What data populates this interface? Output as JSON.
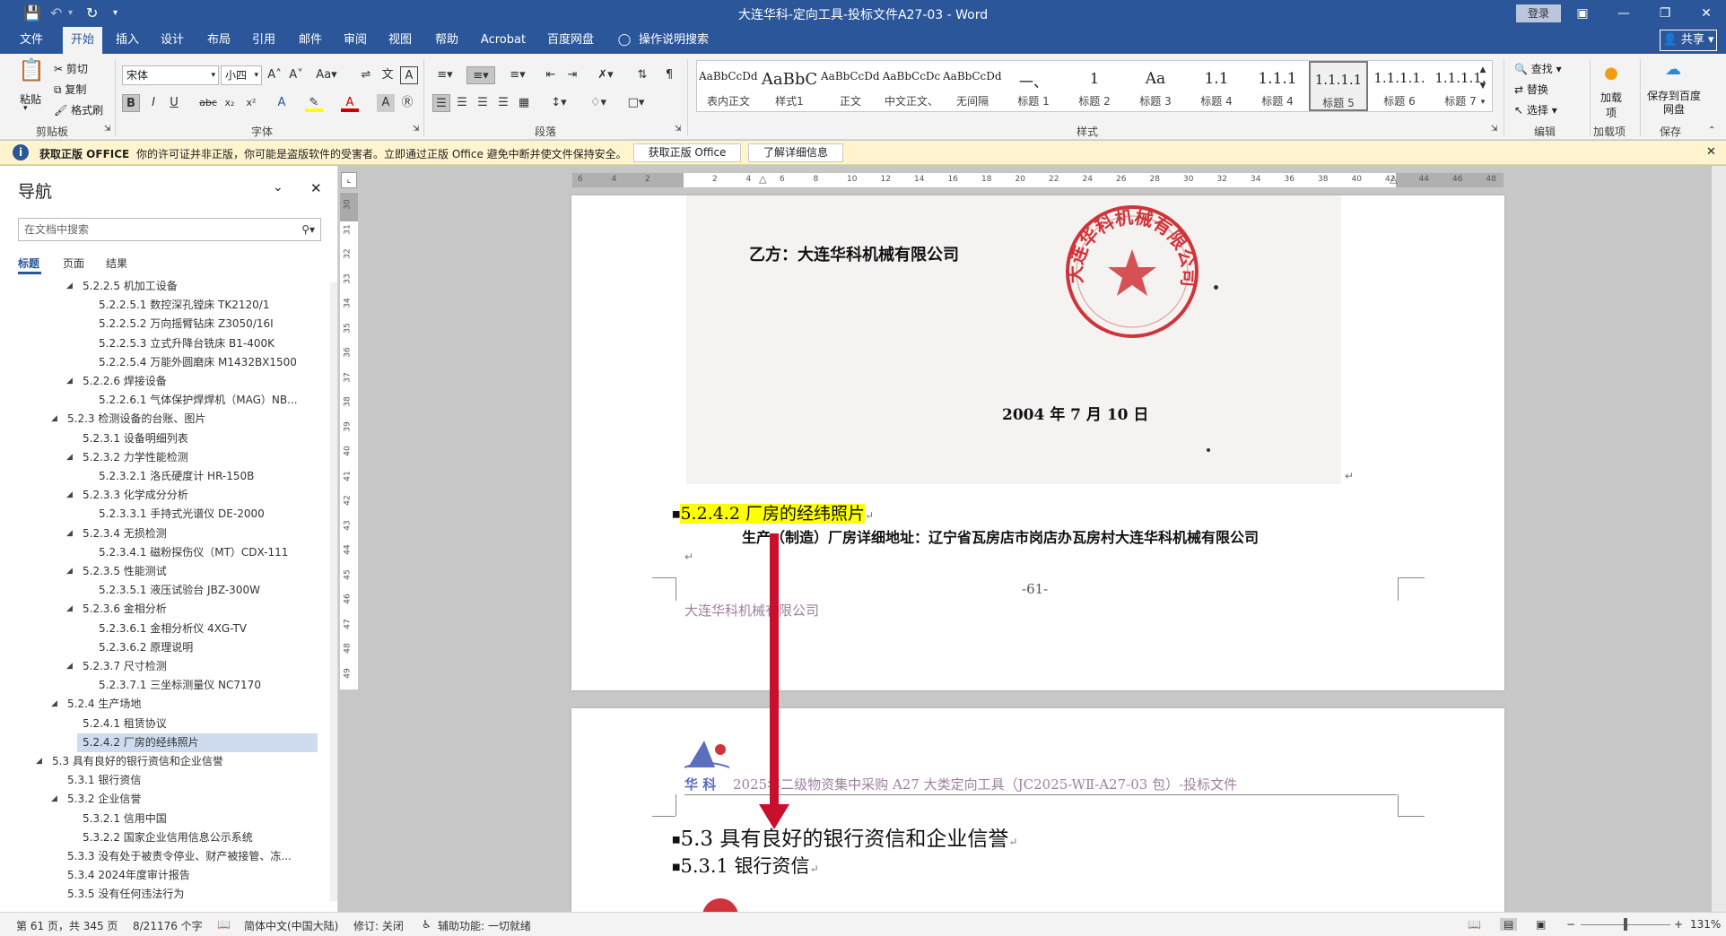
{
  "title": {
    "window_title": "大连华科-定向工具-投标文件A27-03 - Word",
    "login": "登录"
  },
  "menu": {
    "tabs": [
      "文件",
      "开始",
      "插入",
      "设计",
      "布局",
      "引用",
      "邮件",
      "审阅",
      "视图",
      "帮助",
      "Acrobat",
      "百度网盘"
    ],
    "active_tab": "开始",
    "tell_me": "操作说明搜索",
    "share": "共享"
  },
  "ribbon": {
    "clipboard": {
      "paste": "粘贴",
      "cut": "剪切",
      "copy": "复制",
      "format_painter": "格式刷",
      "label": "剪贴板"
    },
    "font": {
      "name": "宋体",
      "size": "小四",
      "label": "字体"
    },
    "paragraph": {
      "label": "段落"
    },
    "styles": {
      "label": "样式",
      "items": [
        {
          "sample": "AaBbCcDdI",
          "name": "表内正文"
        },
        {
          "sample": "AaBbC",
          "name": "样式1"
        },
        {
          "sample": "AaBbCcDdI",
          "name": "正文"
        },
        {
          "sample": "AaBbCcDc",
          "name": "中文正文、"
        },
        {
          "sample": "AaBbCcDdI",
          "name": "无间隔"
        },
        {
          "sample": "一、",
          "name": "标题 1"
        },
        {
          "sample": "1",
          "name": "标题 2"
        },
        {
          "sample": "Aa",
          "name": "标题 3"
        },
        {
          "sample": "1.1",
          "name": "标题 4"
        },
        {
          "sample": "1.1.1",
          "name": "标题 4"
        },
        {
          "sample": "1.1.1.1",
          "name": "标题 5"
        },
        {
          "sample": "1.1.1.1.",
          "name": "标题 6"
        },
        {
          "sample": "1.1.1.1.",
          "name": "标题 7"
        }
      ],
      "selected": "标题 5"
    },
    "editing": {
      "find": "查找",
      "replace": "替换",
      "select": "选择",
      "label": "编辑"
    },
    "addins": {
      "add": "加载项",
      "label": "加载项"
    },
    "save": {
      "save_to": "保存到百度网盘",
      "label": "保存"
    }
  },
  "notify": {
    "title": "获取正版 OFFICE",
    "message": "你的许可证并非正版，你可能是盗版软件的受害者。立即通过正版 Office 避免中断并使文件保持安全。",
    "btn_get": "获取正版 Office",
    "btn_more": "了解详细信息"
  },
  "nav": {
    "title": "导航",
    "search_placeholder": "在文档中搜索",
    "tabs": [
      "标题",
      "页面",
      "结果"
    ],
    "items": [
      {
        "text": "5.2.2.5 机加工设备",
        "level": 4,
        "toggle": true
      },
      {
        "text": "5.2.2.5.1 数控深孔镗床 TK2120/1",
        "level": 5
      },
      {
        "text": "5.2.2.5.2 万向摇臂钻床 Z3050/16I",
        "level": 5
      },
      {
        "text": "5.2.2.5.3 立式升降台铣床 B1-400K",
        "level": 5
      },
      {
        "text": "5.2.2.5.4 万能外圆磨床 M1432BX1500",
        "level": 5
      },
      {
        "text": "5.2.2.6 焊接设备",
        "level": 4,
        "toggle": true
      },
      {
        "text": "5.2.2.6.1 气体保护焊焊机（MAG）NB...",
        "level": 5
      },
      {
        "text": "5.2.3 检测设备的台账、图片",
        "level": 3,
        "toggle": true
      },
      {
        "text": "5.2.3.1 设备明细列表",
        "level": 4
      },
      {
        "text": "5.2.3.2 力学性能检测",
        "level": 4,
        "toggle": true
      },
      {
        "text": "5.2.3.2.1 洛氏硬度计 HR-150B",
        "level": 5
      },
      {
        "text": "5.2.3.3 化学成分分析",
        "level": 4,
        "toggle": true
      },
      {
        "text": "5.2.3.3.1 手持式光谱仪 DE-2000",
        "level": 5
      },
      {
        "text": "5.2.3.4 无损检测",
        "level": 4,
        "toggle": true
      },
      {
        "text": "5.2.3.4.1 磁粉探伤仪（MT）CDX-111",
        "level": 5
      },
      {
        "text": "5.2.3.5 性能测试",
        "level": 4,
        "toggle": true
      },
      {
        "text": "5.2.3.5.1 液压试验台 JBZ-300W",
        "level": 5
      },
      {
        "text": "5.2.3.6 金相分析",
        "level": 4,
        "toggle": true
      },
      {
        "text": "5.2.3.6.1 金相分析仪 4XG-TV",
        "level": 5
      },
      {
        "text": "5.2.3.6.2 原理说明",
        "level": 5
      },
      {
        "text": "5.2.3.7 尺寸检测",
        "level": 4,
        "toggle": true
      },
      {
        "text": "5.2.3.7.1 三坐标测量仪 NC7170",
        "level": 5
      },
      {
        "text": "5.2.4 生产场地",
        "level": 3,
        "toggle": true
      },
      {
        "text": "5.2.4.1 租赁协议",
        "level": 4
      },
      {
        "text": "5.2.4.2 厂房的经纬照片",
        "level": 4,
        "selected": true
      },
      {
        "text": "5.3 具有良好的银行资信和企业信誉",
        "level": 2,
        "toggle": true
      },
      {
        "text": "5.3.1 银行资信",
        "level": 3
      },
      {
        "text": "5.3.2 企业信誉",
        "level": 3,
        "toggle": true
      },
      {
        "text": "5.3.2.1 信用中国",
        "level": 4
      },
      {
        "text": "5.3.2.2 国家企业信用信息公示系统",
        "level": 4
      },
      {
        "text": "5.3.3 没有处于被责令停业、财产被接管、冻...",
        "level": 3
      },
      {
        "text": "5.3.4 2024年度审计报告",
        "level": 3
      },
      {
        "text": "5.3.5 没有任何违法行为",
        "level": 3
      }
    ]
  },
  "ruler": {
    "h_ticks": [
      "6",
      "4",
      "2",
      "",
      "2",
      "4",
      "6",
      "8",
      "10",
      "12",
      "14",
      "16",
      "18",
      "20",
      "22",
      "24",
      "26",
      "28",
      "30",
      "32",
      "34",
      "36",
      "38",
      "40",
      "42",
      "44",
      "46",
      "48"
    ],
    "v_ticks": [
      "30",
      "31",
      "32",
      "33",
      "34",
      "35",
      "36",
      "37",
      "38",
      "39",
      "40",
      "41",
      "42",
      "43",
      "44",
      "45",
      "46",
      "47",
      "48",
      "49"
    ]
  },
  "document": {
    "page1": {
      "scan_party": "乙方：大连华科机械有限公司",
      "scan_date": "2004 年 7 月 10 日",
      "stamp_text": "大连华科机械有限公司",
      "heading": "5.2.4.2 厂房的经纬照片",
      "address": "生产（制造）厂房详细地址：辽宁省瓦房店市岗店办瓦房村大连华科机械有限公司",
      "page_number": "-61-",
      "footer": "大连华科机械有限公司"
    },
    "page2": {
      "logo_text": "华 科",
      "header": "2025年二级物资集中采购 A27 大类定向工具（JC2025-WⅡ-A27-03 包）-投标文件",
      "heading1": "5.3 具有良好的银行资信和企业信誉",
      "heading2": "5.3.1 银行资信"
    }
  },
  "status": {
    "page": "第 61 页，共 345 页",
    "words": "8/21176 个字",
    "language": "简体中文(中国大陆)",
    "track": "修订: 关闭",
    "accessibility": "辅助功能: 一切就绪",
    "zoom": "131%"
  },
  "colors": {
    "accent": "#2b579a",
    "highlight": "#ffff00",
    "arrow": "#c8102e",
    "stamp": "#d0343a"
  }
}
